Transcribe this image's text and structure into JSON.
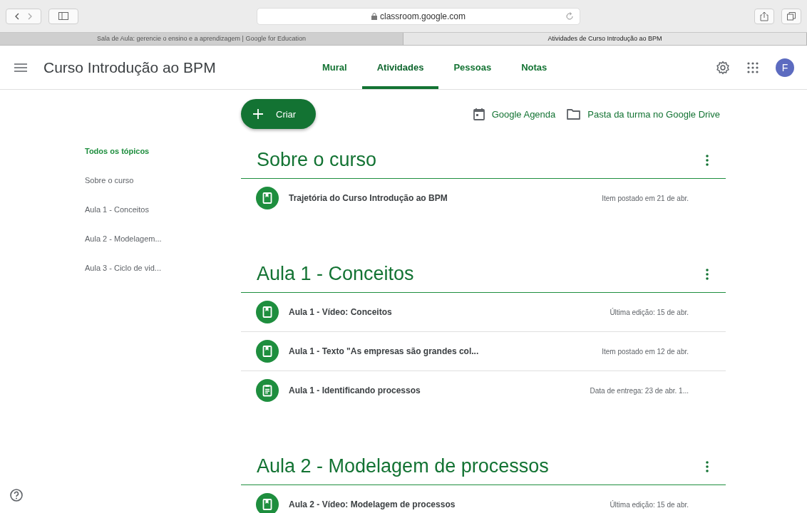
{
  "browser": {
    "address": "classroom.google.com",
    "tabs": [
      {
        "label": "Sala de Aula: gerencie o ensino e a aprendizagem | Google for Education",
        "selected": false
      },
      {
        "label": "Atividades de Curso Introdução ao BPM",
        "selected": true
      }
    ]
  },
  "header": {
    "title": "Curso Introdução ao BPM",
    "nav": [
      {
        "label": "Mural",
        "selected": false
      },
      {
        "label": "Atividades",
        "selected": true
      },
      {
        "label": "Pessoas",
        "selected": false
      },
      {
        "label": "Notas",
        "selected": false
      }
    ],
    "avatar": "F"
  },
  "toolbar": {
    "create": "Criar",
    "links": [
      {
        "kind": "calendar",
        "label": "Google Agenda"
      },
      {
        "kind": "folder",
        "label": "Pasta da turma no Google Drive"
      }
    ]
  },
  "topics": [
    {
      "label": "Todos os tópicos",
      "selected": true
    },
    {
      "label": "Sobre o curso",
      "selected": false
    },
    {
      "label": "Aula 1 - Conceitos",
      "selected": false
    },
    {
      "label": "Aula 2 - Modelagem...",
      "selected": false
    },
    {
      "label": "Aula 3 - Ciclo de vid...",
      "selected": false
    }
  ],
  "sections": [
    {
      "title": "Sobre o curso",
      "items": [
        {
          "kind": "material",
          "title": "Trajetória do Curso Introdução ao BPM",
          "meta": "Item postado em 21 de abr."
        }
      ]
    },
    {
      "title": "Aula 1 - Conceitos",
      "items": [
        {
          "kind": "material",
          "title": "Aula 1 - Vídeo: Conceitos",
          "meta": "Última edição: 15 de abr."
        },
        {
          "kind": "material",
          "title": "Aula 1 - Texto \"As empresas são grandes col...",
          "meta": "Item postado em 12 de abr."
        },
        {
          "kind": "assignment",
          "title": "Aula 1 - Identificando processos",
          "meta": "Data de entrega: 23 de abr. 1..."
        }
      ]
    },
    {
      "title": "Aula 2 - Modelagem de processos",
      "items": [
        {
          "kind": "material",
          "title": "Aula 2 - Vídeo: Modelagem de processos",
          "meta": "Última edição: 15 de abr."
        }
      ]
    }
  ]
}
